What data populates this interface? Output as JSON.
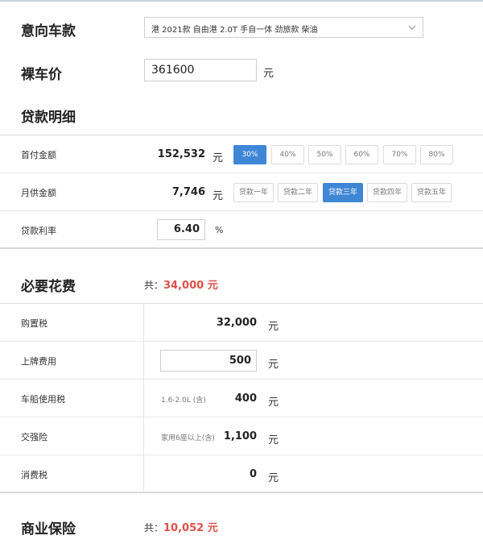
{
  "model": {
    "label": "意向车款",
    "selected": "港 2021款 自由港 2.0T 手自一体 劲旅款 柴油"
  },
  "bare_price": {
    "label": "裸车价",
    "value": "361600",
    "unit": "元"
  },
  "loan": {
    "title": "贷款明细",
    "down_payment": {
      "label": "首付金额",
      "value": "152,532",
      "unit": "元",
      "options": [
        "30%",
        "40%",
        "50%",
        "60%",
        "70%",
        "80%"
      ],
      "selected": "30%"
    },
    "monthly": {
      "label": "月供金额",
      "value": "7,746",
      "unit": "元",
      "options": [
        "贷款一年",
        "贷款二年",
        "贷款三年",
        "贷款四年",
        "贷款五年"
      ],
      "selected": "贷款三年"
    },
    "rate": {
      "label": "贷款利率",
      "value": "6.40",
      "unit": "%"
    }
  },
  "necessary": {
    "title": "必要花费",
    "total_prefix": "共：",
    "total": "34,000 元",
    "rows": {
      "purchase_tax": {
        "label": "购置税",
        "value": "32,000",
        "unit": "元"
      },
      "plate_fee": {
        "label": "上牌费用",
        "value": "500",
        "unit": "元"
      },
      "vehicle_tax": {
        "label": "车船使用税",
        "note": "1.6-2.0L (含)",
        "value": "400",
        "unit": "元"
      },
      "compulsory": {
        "label": "交强险",
        "note": "家用6座以上(含)",
        "value": "1,100",
        "unit": "元"
      },
      "consumption_tax": {
        "label": "消费税",
        "value": "0",
        "unit": "元"
      }
    }
  },
  "commercial": {
    "title": "商业保险",
    "total_prefix": "共：",
    "total": "10,052 元"
  },
  "colors": {
    "accent": "#3f86d6",
    "highlight": "#e0504a"
  }
}
